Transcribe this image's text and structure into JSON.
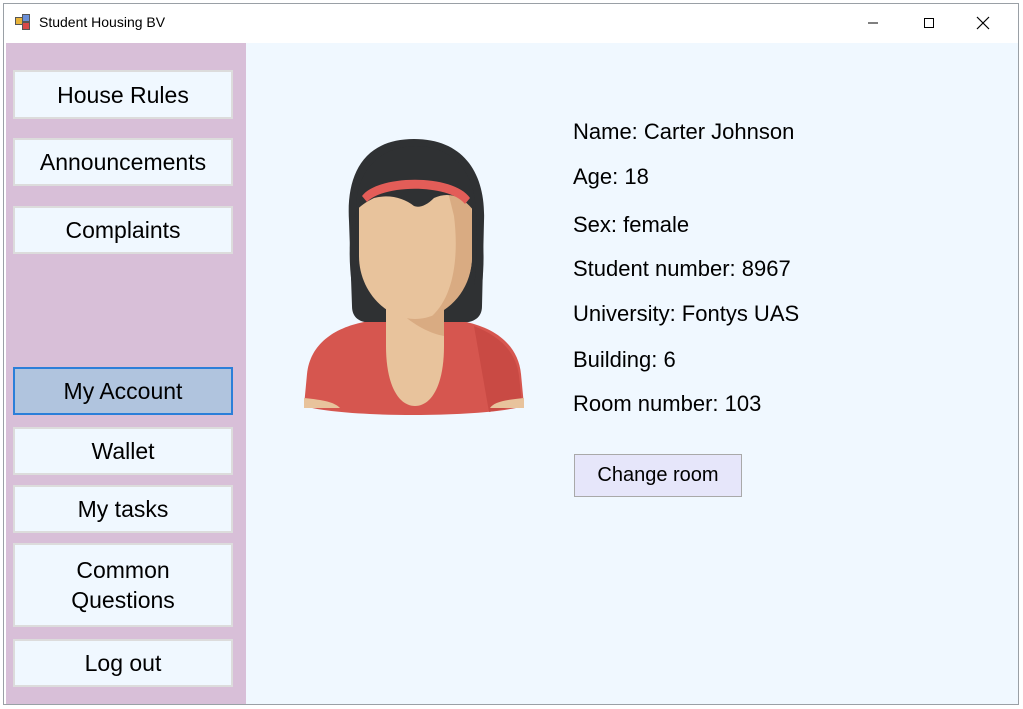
{
  "window": {
    "title": "Student Housing BV"
  },
  "sidebar": {
    "items": [
      {
        "label": "House Rules"
      },
      {
        "label": "Announcements"
      },
      {
        "label": "Complaints"
      },
      {
        "label": "My Account",
        "selected": true
      },
      {
        "label": "Wallet"
      },
      {
        "label": "My tasks"
      },
      {
        "label": "Common\nQuestions"
      },
      {
        "label": "Log out"
      }
    ]
  },
  "profile": {
    "name": "Name: Carter Johnson",
    "age": "Age: 18",
    "sex": "Sex: female",
    "student_number": "Student number: 8967",
    "university": "University: Fontys UAS",
    "building": "Building: 6",
    "room_number": "Room number: 103",
    "avatar_icon": "female-avatar-icon"
  },
  "actions": {
    "change_room_label": "Change room"
  },
  "colors": {
    "sidebar_bg": "#d8bfd8",
    "main_bg": "#f0f8ff",
    "selected_button_bg": "#b0c4de",
    "selected_button_border": "#2b7fd9",
    "change_room_bg": "#e6e6fa"
  }
}
